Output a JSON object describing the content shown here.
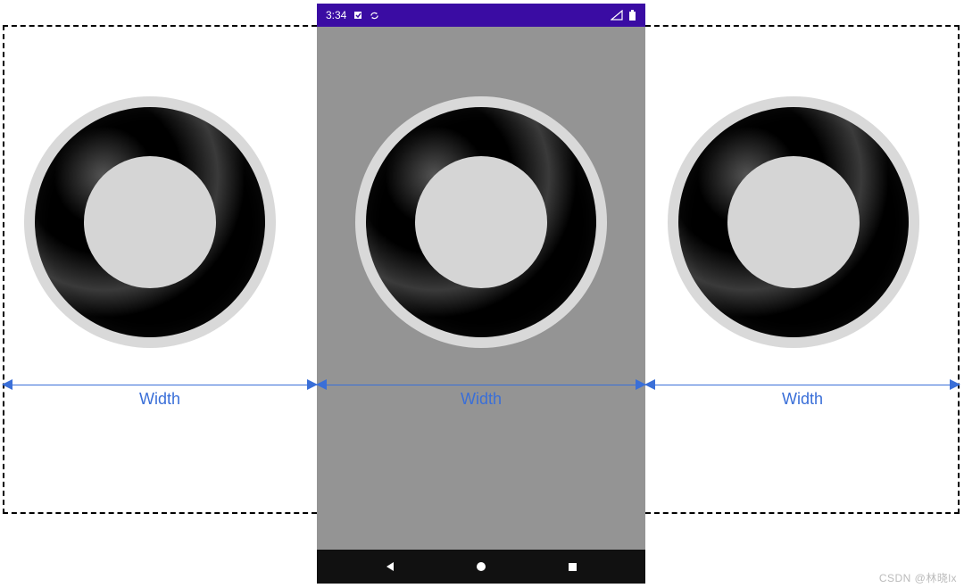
{
  "status_bar": {
    "time": "3:34",
    "indicators_left": [
      "debug-icon",
      "sync-icon"
    ],
    "indicators_right": [
      "signal-icon",
      "battery-icon"
    ]
  },
  "annotations": {
    "segments": [
      {
        "label": "Width"
      },
      {
        "label": "Width"
      },
      {
        "label": "Width"
      }
    ]
  },
  "nav": {
    "buttons": [
      "back",
      "home",
      "recent"
    ]
  },
  "watermark": "CSDN @林晓lx"
}
